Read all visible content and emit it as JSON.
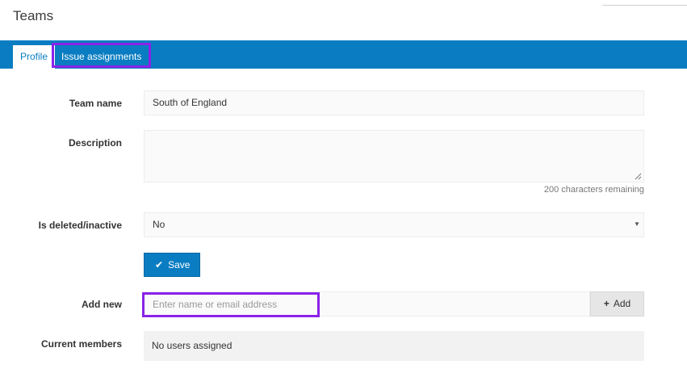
{
  "header": {
    "title": "Teams"
  },
  "tabs": [
    {
      "label": "Profile",
      "active": true
    },
    {
      "label": "Issue assignments",
      "active": false
    }
  ],
  "form": {
    "team_name": {
      "label": "Team name",
      "value": "South of England"
    },
    "description": {
      "label": "Description",
      "value": "",
      "remaining_text": "200 characters remaining"
    },
    "deleted": {
      "label": "Is deleted/inactive",
      "selected": "No"
    },
    "save_label": "Save",
    "add_new": {
      "label": "Add new",
      "placeholder": "Enter name or email address",
      "button_label": "Add"
    },
    "members": {
      "label": "Current members",
      "empty_text": "No users assigned"
    }
  },
  "colors": {
    "accent": "#0a7dc2",
    "highlight": "#8a22e8"
  },
  "icons": {
    "save": "check-icon",
    "add": "plus-icon",
    "select": "caret-down-icon"
  }
}
